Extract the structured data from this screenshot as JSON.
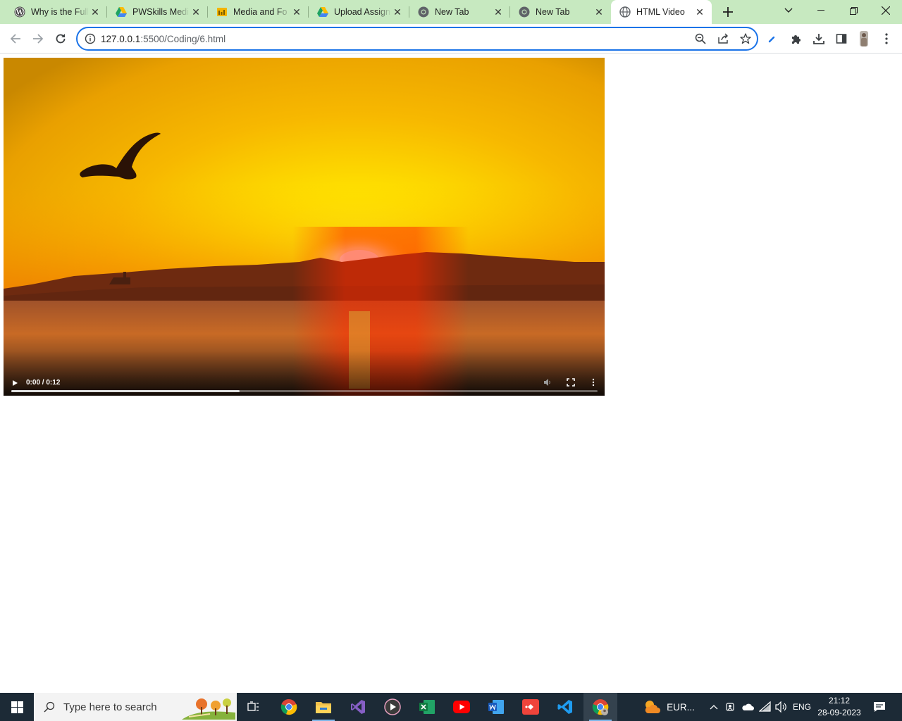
{
  "browser": {
    "tabs": [
      {
        "title": "Why is the Full",
        "icon": "wordpress-icon",
        "active": false
      },
      {
        "title": "PWSkills Medi",
        "icon": "google-drive-icon",
        "active": false
      },
      {
        "title": "Media and Fo",
        "icon": "slides-icon",
        "active": false
      },
      {
        "title": "Upload Assign",
        "icon": "google-drive-icon",
        "active": false
      },
      {
        "title": "New Tab",
        "icon": "chrome-icon",
        "active": false
      },
      {
        "title": "New Tab",
        "icon": "chrome-icon",
        "active": false
      },
      {
        "title": "HTML Video",
        "icon": "globe-icon",
        "active": true
      }
    ],
    "address": {
      "host": "127.0.0.1",
      "path": ":5500/Coding/6.html"
    }
  },
  "video": {
    "current_time": "0:00",
    "duration": "0:12",
    "time_separator": " / ",
    "buffered": 0.39
  },
  "taskbar": {
    "search_placeholder": "Type here to search",
    "weather_text": "EUR...",
    "language": "ENG",
    "time": "21:12",
    "date": "28-09-2023"
  },
  "colors": {
    "tabstrip": "#c7e9c0",
    "accent": "#1a73e8",
    "taskbar": "#1c2a36"
  }
}
